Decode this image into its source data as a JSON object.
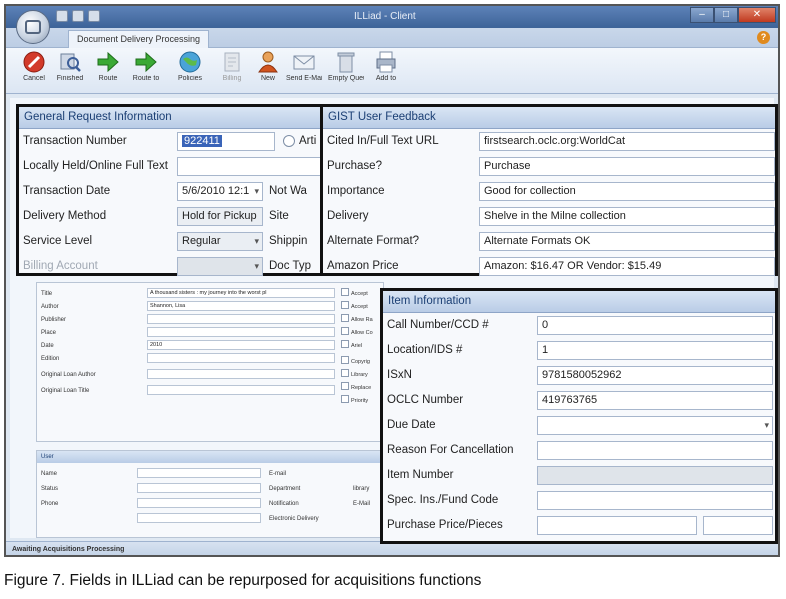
{
  "window": {
    "title": "ILLiad - Client",
    "ribbon_tab": "Document Delivery Processing"
  },
  "ribbon": {
    "buttons": [
      {
        "label": "Cancel",
        "icon": "cancel-icon",
        "enabled": true
      },
      {
        "label": "Finished",
        "icon": "finished-search-icon",
        "enabled": true
      },
      {
        "label": "Route",
        "icon": "route-arrow-icon",
        "enabled": true
      },
      {
        "label": "Route to",
        "icon": "route-to-arrow-icon",
        "enabled": true
      },
      {
        "label": "Policies",
        "icon": "globe-icon",
        "enabled": true
      },
      {
        "label": "Billing",
        "icon": "billing-icon",
        "enabled": false
      },
      {
        "label": "New",
        "icon": "new-user-icon",
        "enabled": true
      },
      {
        "label": "Send E-Mail",
        "icon": "email-icon",
        "enabled": true
      },
      {
        "label": "Empty Queue",
        "icon": "trash-icon",
        "enabled": true
      },
      {
        "label": "Add to",
        "icon": "printer-icon",
        "enabled": true
      }
    ]
  },
  "general": {
    "title": "General Request Information",
    "transaction_number_label": "Transaction Number",
    "transaction_number": "922411",
    "article_label": "Arti",
    "locally_held_label": "Locally Held/Online Full Text",
    "transaction_date_label": "Transaction Date",
    "transaction_date": "5/6/2010 12:1",
    "not_wanted_label": "Not Wa",
    "delivery_method_label": "Delivery Method",
    "delivery_method": "Hold for Pickup",
    "site_label": "Site",
    "service_level_label": "Service Level",
    "service_level": "Regular",
    "shipping_label": "Shippin",
    "billing_account_label": "Billing Account",
    "doc_type_label": "Doc Typ"
  },
  "gist": {
    "title": "GIST User Feedback",
    "rows": [
      {
        "label": "Cited In/Full Text URL",
        "value": "firstsearch.oclc.org:WorldCat"
      },
      {
        "label": "Purchase?",
        "value": "Purchase"
      },
      {
        "label": "Importance",
        "value": "Good for collection"
      },
      {
        "label": "Delivery",
        "value": "Shelve in the Milne collection"
      },
      {
        "label": "Alternate Format?",
        "value": "Alternate Formats OK"
      },
      {
        "label": "Amazon Price",
        "value": "Amazon: $16.47 OR Vendor: $15.49"
      }
    ]
  },
  "citation": {
    "rows": [
      {
        "label": "Title",
        "value": "A thousand sisters : my journey into the worst pl"
      },
      {
        "label": "Author",
        "value": "Shannon, Lisa"
      },
      {
        "label": "Publisher",
        "value": ""
      },
      {
        "label": "Place",
        "value": ""
      },
      {
        "label": "Date",
        "value": "2010"
      },
      {
        "label": "Edition",
        "value": ""
      },
      {
        "label": "Original Loan Author",
        "value": ""
      },
      {
        "label": "Original Loan Title",
        "value": ""
      }
    ],
    "checkboxes": [
      "Accept",
      "Accept",
      "Allow Ra",
      "Allow Co",
      "Ariel",
      "Copyrig",
      "Library",
      "Replace",
      "Priority"
    ]
  },
  "user": {
    "title": "User",
    "name_label": "Name",
    "status_label": "Status",
    "phone_label": "Phone",
    "email_label": "E-mail",
    "department_label": "Department",
    "notification_label": "Notification",
    "electronic_delivery_label": "Electronic Delivery",
    "library_label": "library",
    "email2_label": "E-Mail"
  },
  "item": {
    "title": "Item Information",
    "rows": [
      {
        "label": "Call Number/CCD #",
        "value": "0"
      },
      {
        "label": "Location/IDS #",
        "value": "1"
      },
      {
        "label": "ISxN",
        "value": "9781580052962"
      },
      {
        "label": "OCLC Number",
        "value": "419763765"
      },
      {
        "label": "Due Date",
        "value": ""
      },
      {
        "label": "Reason For Cancellation",
        "value": ""
      },
      {
        "label": "Item Number",
        "value": ""
      },
      {
        "label": "Spec. Ins./Fund Code",
        "value": ""
      },
      {
        "label": "Purchase Price/Pieces",
        "value": ""
      }
    ]
  },
  "status_bar": "Awaiting Acquisitions Processing",
  "caption": "Figure 7. Fields in ILLiad can be repurposed for acquisitions functions"
}
